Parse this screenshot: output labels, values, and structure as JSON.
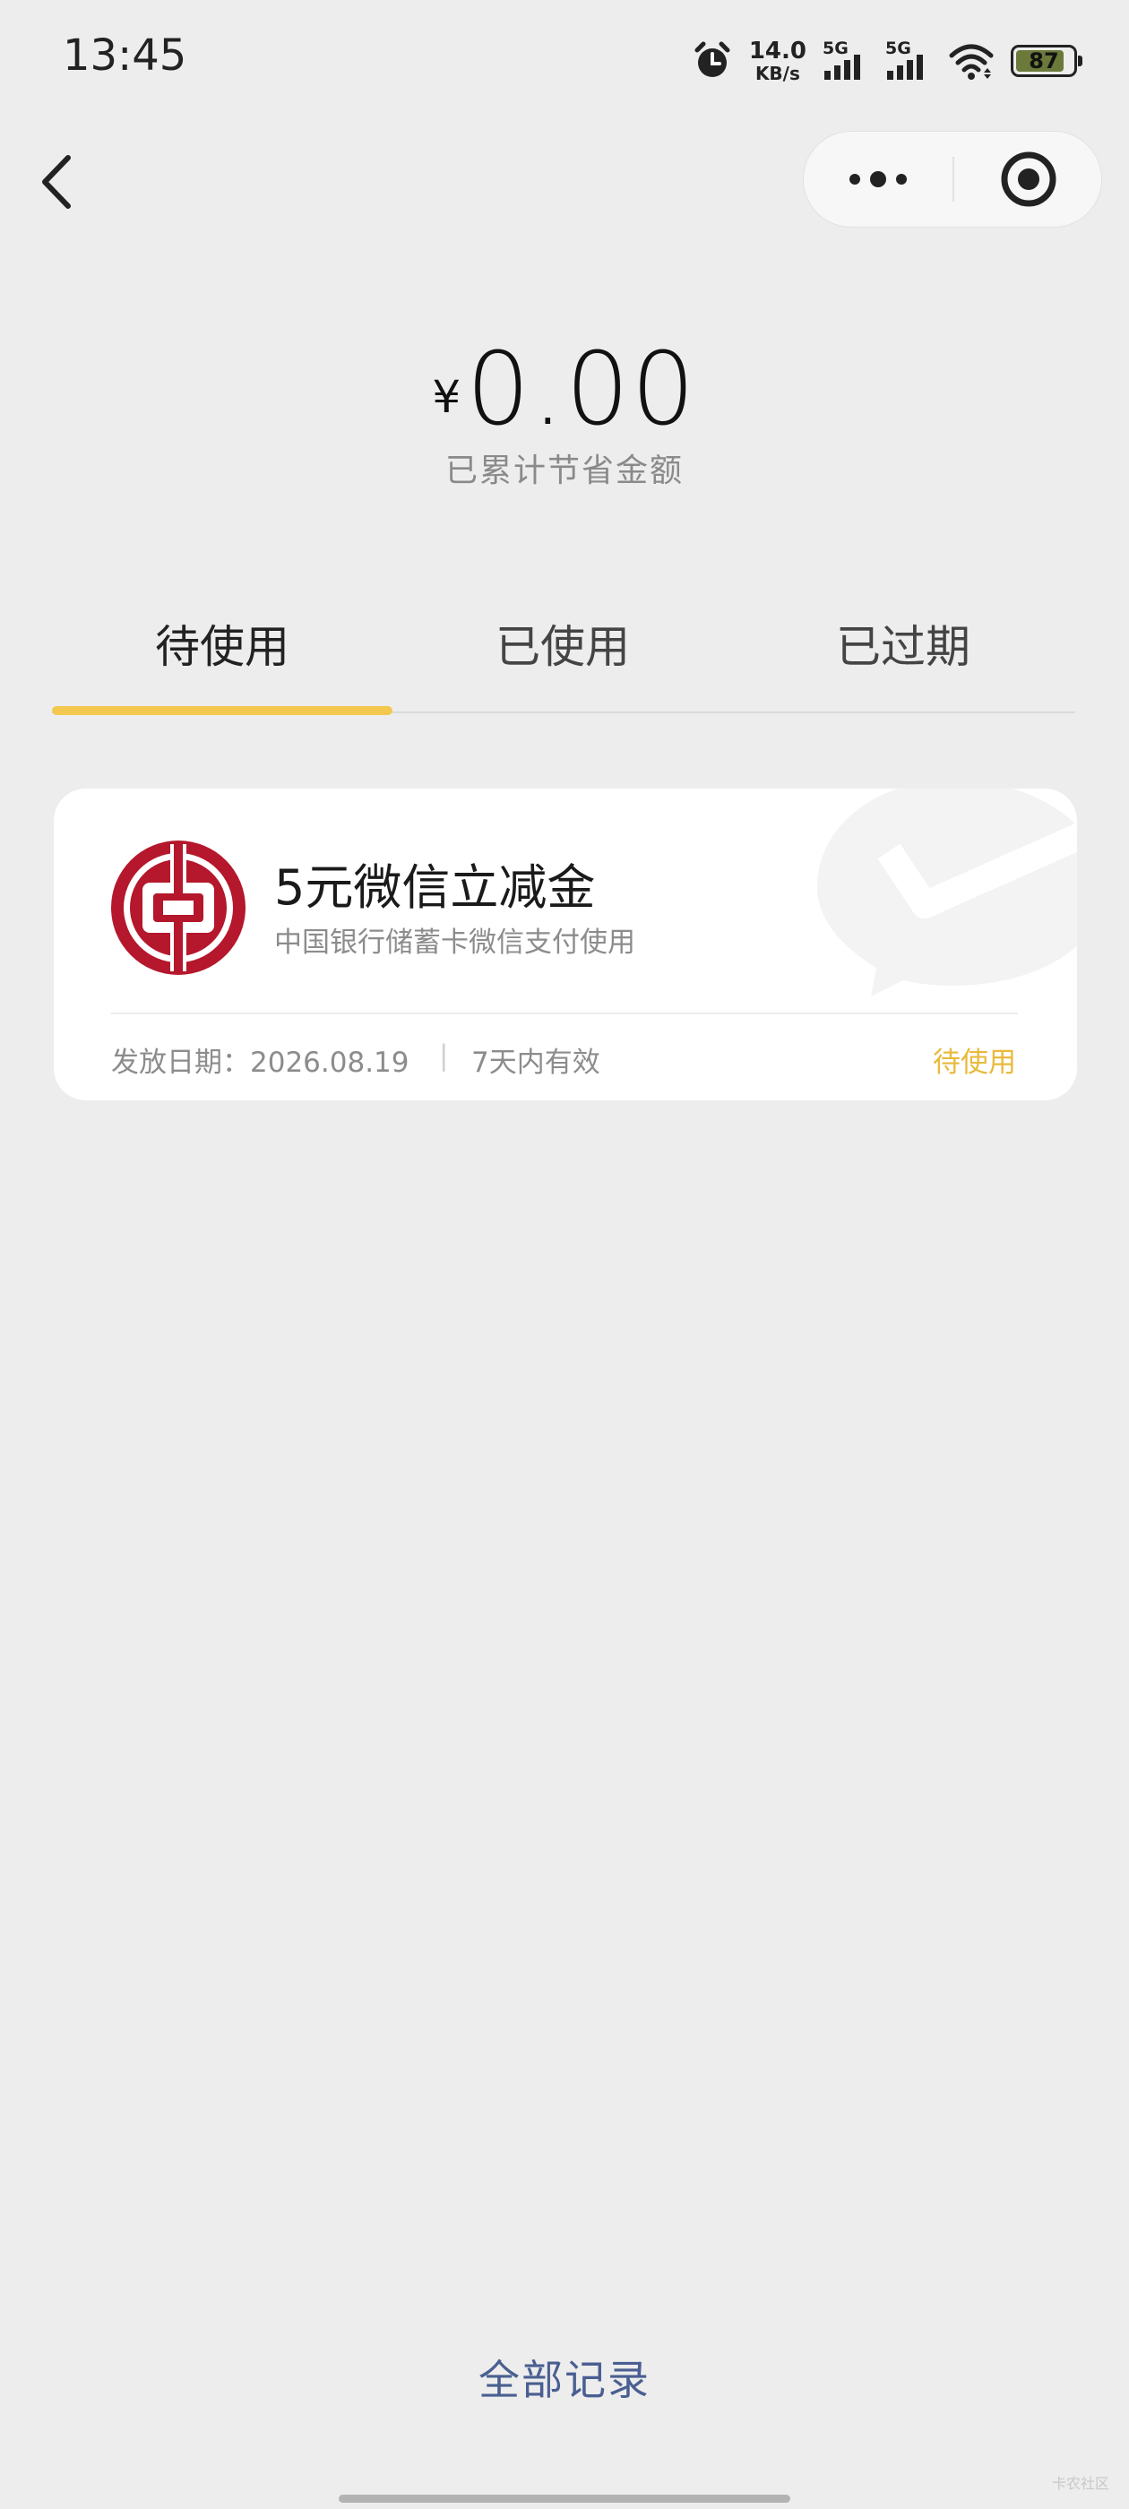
{
  "status_bar": {
    "time": "13:45",
    "net_speed_value": "14.0",
    "net_speed_unit": "KB/s",
    "sim1_label": "5G",
    "sim2_label": "5G",
    "battery_level": "87",
    "icons": [
      "alarm-icon",
      "signal-icon",
      "wifi-icon",
      "battery-icon"
    ]
  },
  "nav": {
    "back_icon": "chevron-left-icon",
    "more_icon": "more-dots-icon",
    "close_icon": "target-close-icon"
  },
  "savings": {
    "currency": "¥",
    "amount": "0.00",
    "label": "已累计节省金额"
  },
  "tabs": [
    {
      "label": "待使用",
      "active": true
    },
    {
      "label": "已使用",
      "active": false
    },
    {
      "label": "已过期",
      "active": false
    }
  ],
  "coupon": {
    "title": "5元微信立减金",
    "subtitle": "中国银行储蓄卡微信支付使用",
    "issue_date": "发放日期：2026.08.19",
    "separator": "|",
    "validity": "7天内有效",
    "status": "待使用"
  },
  "footer": {
    "all_records": "全部记录",
    "corner_text": "卡农社区"
  },
  "colors": {
    "background": "#ededed",
    "accent_yellow": "#f4c84e",
    "status_yellow": "#e9b93a",
    "link_blue": "#4a5f91",
    "boc_red": "#b5172c"
  }
}
